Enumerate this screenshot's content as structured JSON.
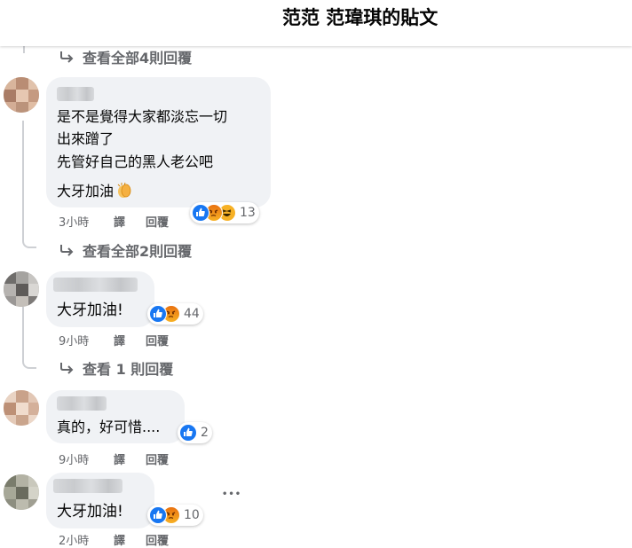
{
  "header": {
    "title": "范范 范瑋琪的貼文"
  },
  "colors": {
    "accent_like": "#1877f2",
    "bubble": "#f0f2f5",
    "meta_text": "#65676b"
  },
  "thread": [
    {
      "view_replies": "查看全部4則回覆"
    },
    {
      "comment": {
        "lines": [
          "是不是覺得大家都淡忘一切",
          "出來蹭了",
          "先管好自己的黑人老公吧",
          "大牙加油"
        ],
        "emoji": "clapping-hands",
        "reactions": [
          "like",
          "angry",
          "haha"
        ],
        "reaction_count": "13",
        "time": "3小時",
        "translate": "譯",
        "reply": "回覆"
      },
      "view_replies": "查看全部2則回覆"
    },
    {
      "comment": {
        "text": "大牙加油!",
        "reactions": [
          "like",
          "angry"
        ],
        "reaction_count": "44",
        "time": "9小時",
        "translate": "譯",
        "reply": "回覆"
      },
      "view_replies": "查看 1 則回覆"
    },
    {
      "comment": {
        "text": "真的，好可惜....",
        "reactions": [
          "like"
        ],
        "reaction_count": "2",
        "time": "9小時",
        "translate": "譯",
        "reply": "回覆"
      }
    },
    {
      "comment": {
        "text": "大牙加油!",
        "reactions": [
          "like",
          "angry"
        ],
        "reaction_count": "10",
        "time": "2小時",
        "translate": "譯",
        "reply": "回覆"
      },
      "more": "•••"
    }
  ]
}
